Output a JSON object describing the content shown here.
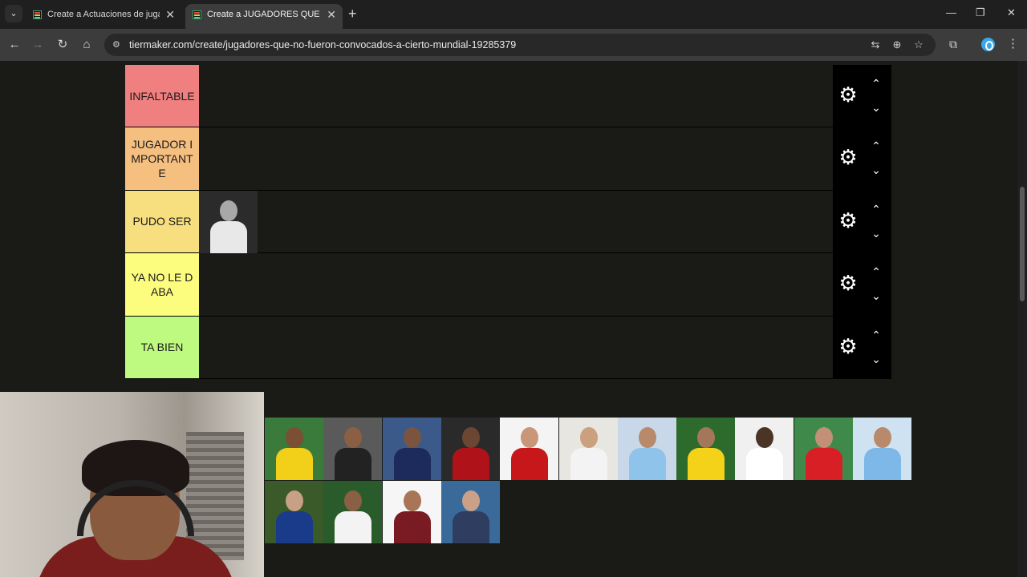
{
  "browser": {
    "tabs": [
      {
        "title": "Create a Actuaciones de jugado",
        "active": false
      },
      {
        "title": "Create a JUGADORES QUE NO F",
        "active": true
      }
    ],
    "url": "tiermaker.com/create/jugadores-que-no-fueron-convocados-a-cierto-mundial-19285379"
  },
  "icons": {
    "tab_list": "chevron-down-icon",
    "tab_close": "close-icon",
    "new_tab": "plus-icon",
    "back": "arrow-left-icon",
    "forward": "arrow-right-icon",
    "reload": "reload-icon",
    "home": "home-icon",
    "site_info": "site-settings-icon",
    "translate": "translate-icon",
    "zoom": "zoom-icon",
    "bookmark": "star-icon",
    "extensions": "puzzle-icon",
    "menu": "kebab-icon",
    "tier_settings": "gear-icon",
    "move_up": "chevron-up-icon",
    "move_down": "chevron-down-icon"
  },
  "glyphs": {
    "tab_list": "⌄",
    "close": "✕",
    "new_tab": "+",
    "back": "←",
    "forward": "→",
    "reload": "↻",
    "home": "⌂",
    "site_info": "⚙",
    "translate": "⇆",
    "zoom": "⊕",
    "bookmark": "☆",
    "extensions": "⧉",
    "menu": "⋮",
    "minimize": "—",
    "maximize": "❐",
    "gear": "⚙",
    "up": "⌃",
    "down": "⌄"
  },
  "tiers": [
    {
      "label": "INFALTABLE",
      "color": "#f07f7f"
    },
    {
      "label": "JUGADOR IMPORTANTE",
      "color": "#f5bf80"
    },
    {
      "label": "PUDO SER",
      "color": "#f7de7f"
    },
    {
      "label": "YA NO LE DABA",
      "color": "#fcfc7f"
    },
    {
      "label": "TA BIEN",
      "color": "#bffa80"
    }
  ],
  "placed_items": [
    {
      "tier": 2,
      "photo": "player-photo-bw"
    }
  ],
  "pool_items": [
    {
      "photo": "player-photo-brazil-yellow"
    },
    {
      "photo": "player-photo-juventus"
    },
    {
      "photo": "player-photo-france-navy"
    },
    {
      "photo": "player-photo-milan"
    },
    {
      "photo": "player-photo-manchester-red"
    },
    {
      "photo": "player-photo-real-madrid-white"
    },
    {
      "photo": "player-photo-argentina-striped"
    },
    {
      "photo": "player-photo-brazil-10"
    },
    {
      "photo": "player-photo-germany-white"
    },
    {
      "photo": "player-photo-switzerland-red"
    },
    {
      "photo": "player-photo-argentina-4"
    },
    {
      "photo": "player-photo-inter"
    },
    {
      "photo": "player-photo-marseille"
    },
    {
      "photo": "player-photo-fluminense"
    },
    {
      "photo": "player-photo-sweden-portrait"
    }
  ]
}
